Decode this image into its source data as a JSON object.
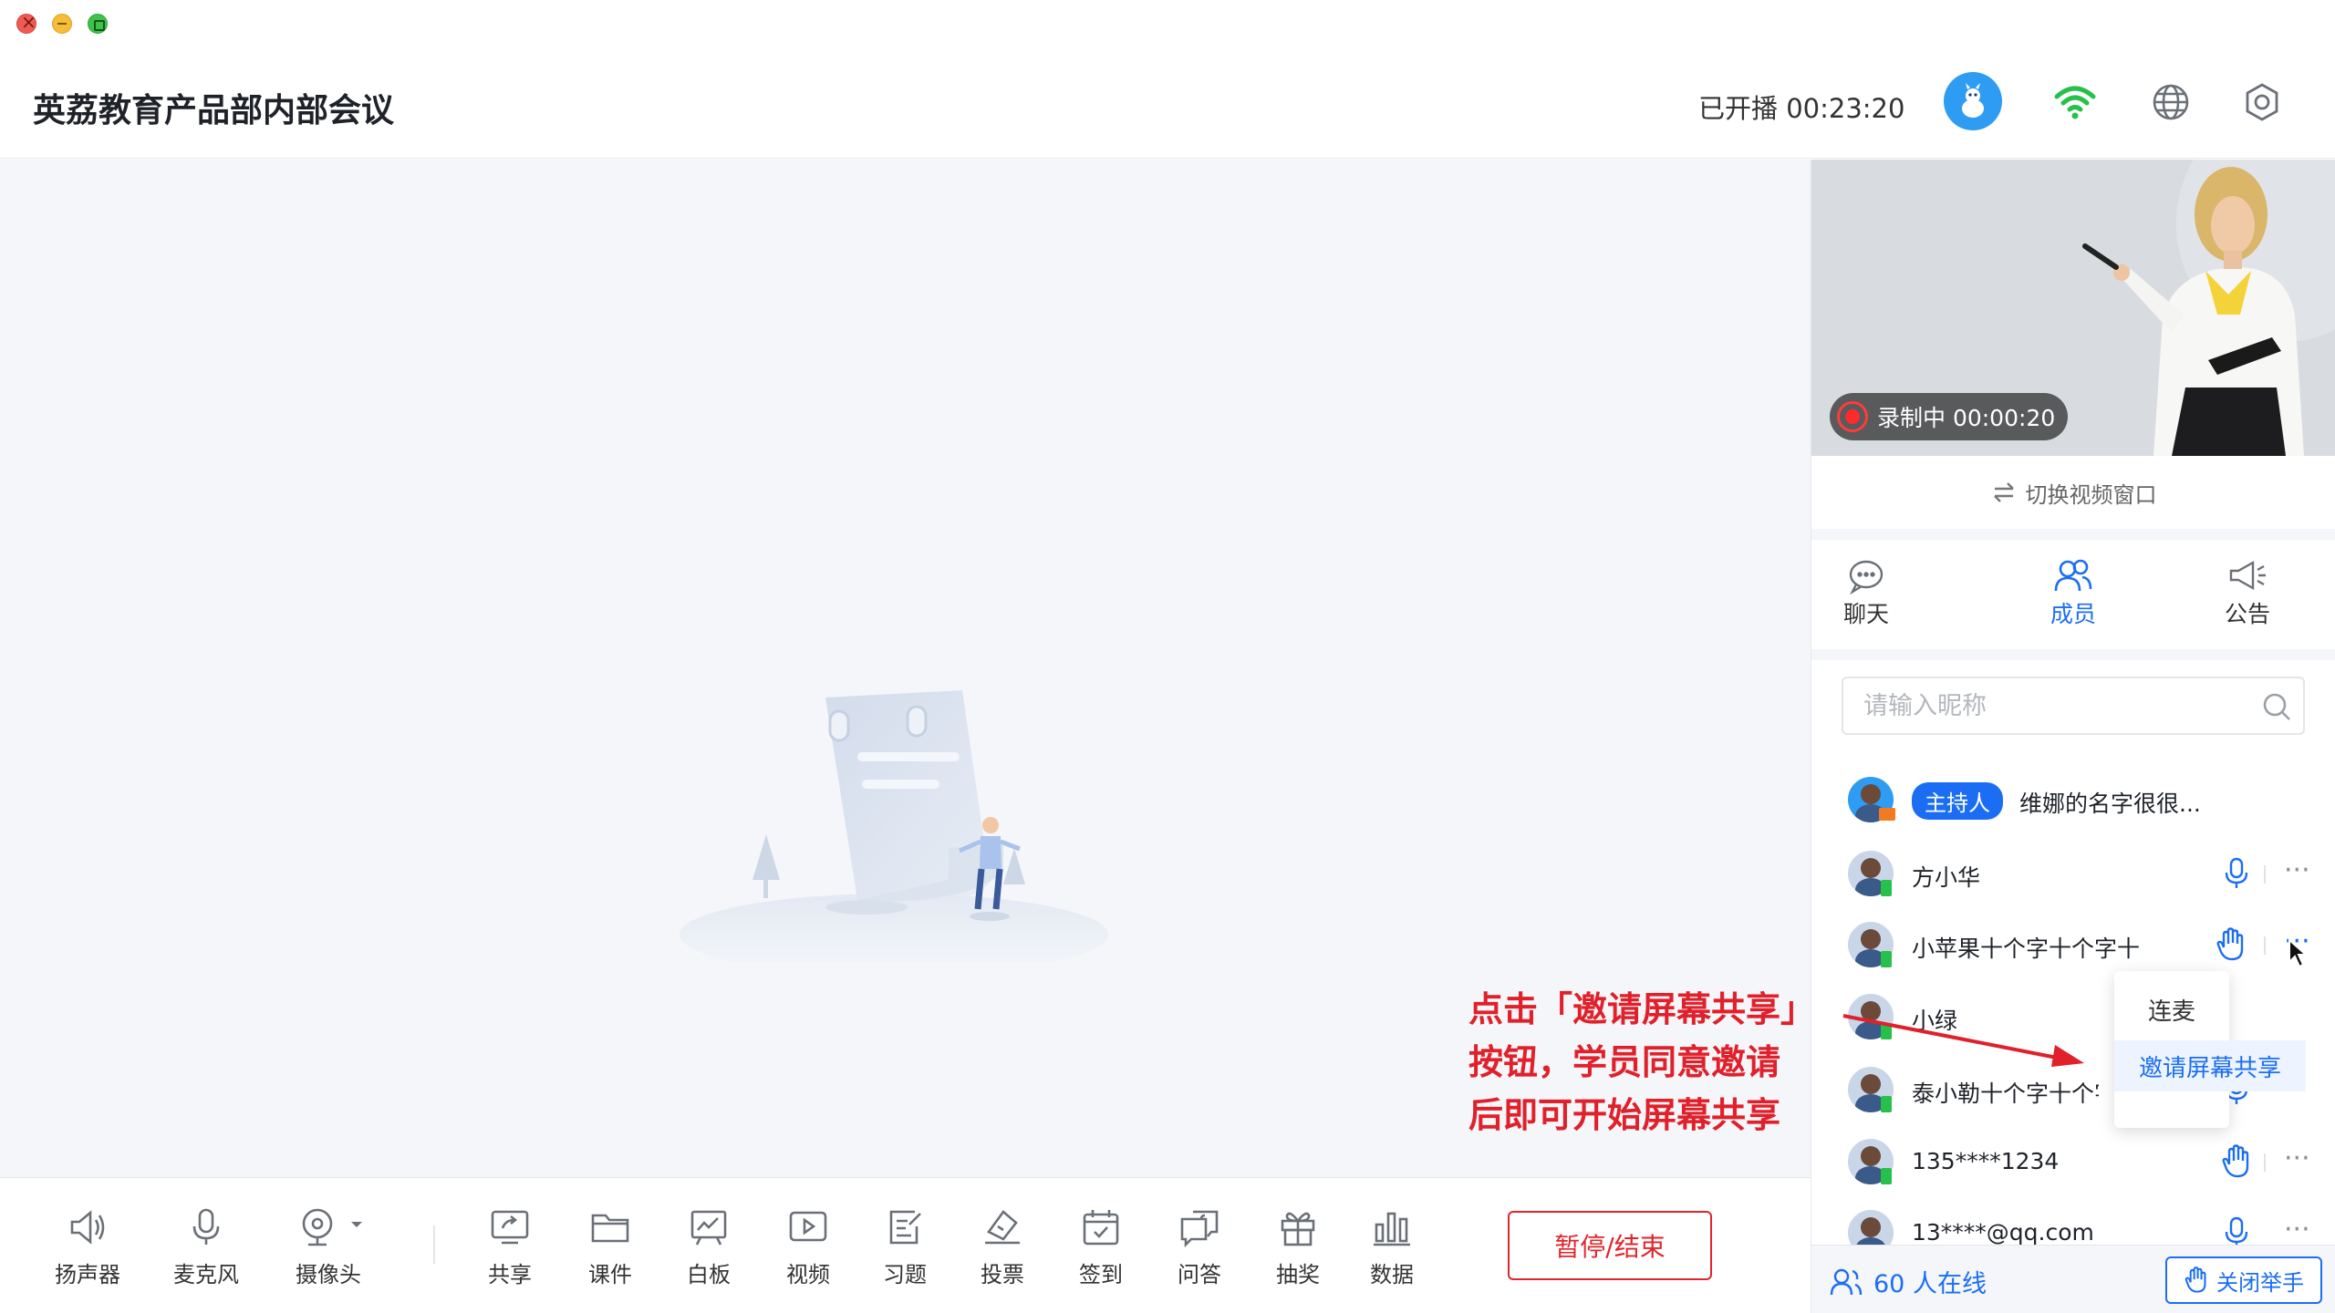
{
  "window": {
    "title": "英荔教育产品部内部会议"
  },
  "header": {
    "title": "英荔教育产品部内部会议",
    "status": "已开播 00:23:20",
    "icons": [
      "wifi-icon",
      "globe-icon",
      "settings-icon"
    ]
  },
  "toolbar": {
    "speaker": "扬声器",
    "mic": "麦克风",
    "camera": "摄像头",
    "share": "共享",
    "courseware": "课件",
    "whiteboard": "白板",
    "video": "视频",
    "exercise": "习题",
    "vote": "投票",
    "checkin": "签到",
    "qa": "问答",
    "lottery": "抽奖",
    "data": "数据",
    "end_button": "暂停/结束"
  },
  "video": {
    "recording": "录制中 00:00:20"
  },
  "side": {
    "switch_video": "切换视频窗口",
    "tabs": {
      "chat": "聊天",
      "members": "成员",
      "notice": "公告"
    },
    "active_tab": "members",
    "search_placeholder": "请输入昵称",
    "host_tag": "主持人",
    "host_name": "维娜的名字很很...",
    "members": [
      {
        "name": "方小华",
        "action": "mic"
      },
      {
        "name": "小苹果十个字十个字十",
        "action": "hand"
      },
      {
        "name": "小绿",
        "action": ""
      },
      {
        "name": "泰小勒十个字十个字十",
        "action": "mic"
      },
      {
        "name": "135****1234",
        "action": "hand"
      },
      {
        "name": "13****@qq.com",
        "action": "mic"
      }
    ],
    "menu": {
      "item1": "连麦",
      "item2": "邀请屏幕共享"
    },
    "online": "60 人在线",
    "close_hands": "关闭举手"
  },
  "annotation": {
    "line1": "点击「邀请屏幕共享」",
    "line2": "按钮，学员同意邀请",
    "line3": "后即可开始屏幕共享"
  },
  "colors": {
    "accent": "#1b6ef3",
    "danger": "#e0252b",
    "online_signal": "#27c04a"
  }
}
